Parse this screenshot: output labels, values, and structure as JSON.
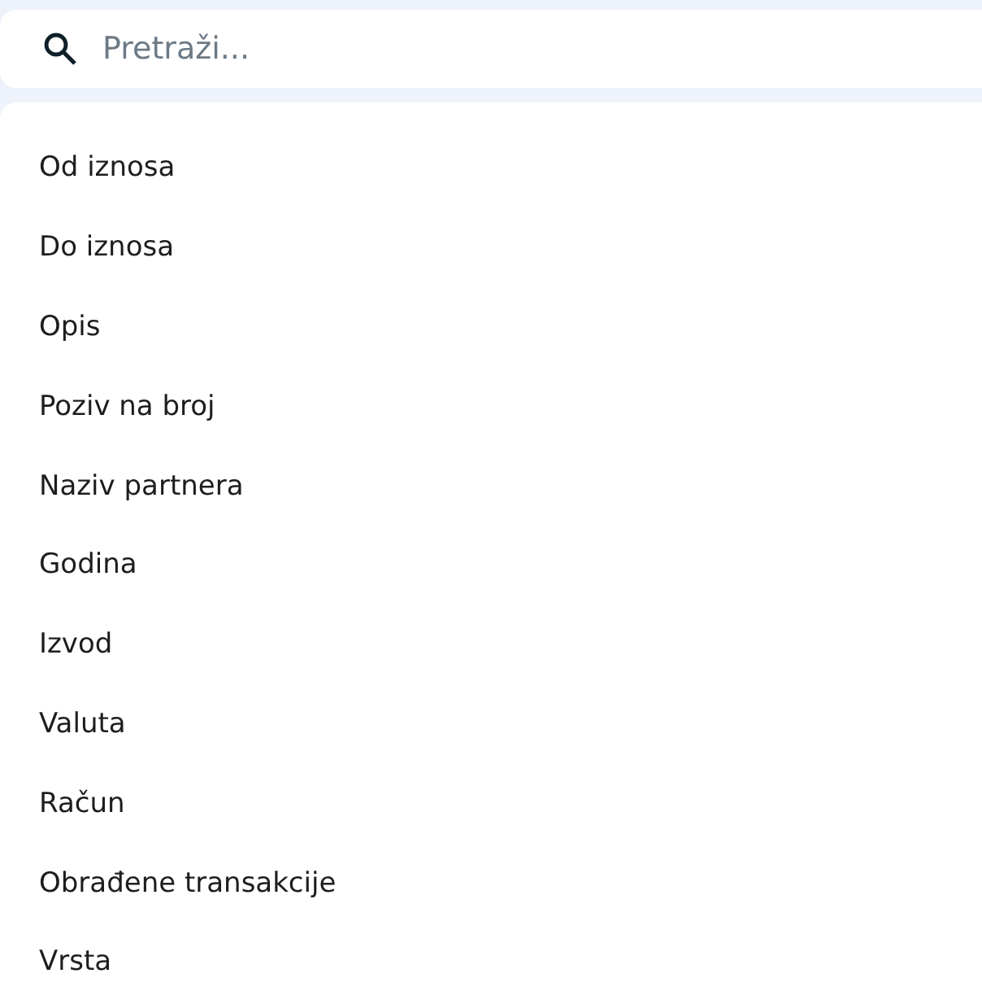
{
  "search": {
    "placeholder": "Pretraži..."
  },
  "menu": {
    "items": [
      {
        "label": "Od iznosa"
      },
      {
        "label": "Do iznosa"
      },
      {
        "label": "Opis"
      },
      {
        "label": "Poziv na broj"
      },
      {
        "label": "Naziv partnera"
      },
      {
        "label": "Godina"
      },
      {
        "label": "Izvod"
      },
      {
        "label": "Valuta"
      },
      {
        "label": "Račun"
      },
      {
        "label": "Obrađene transakcije"
      },
      {
        "label": "Vrsta"
      }
    ]
  }
}
